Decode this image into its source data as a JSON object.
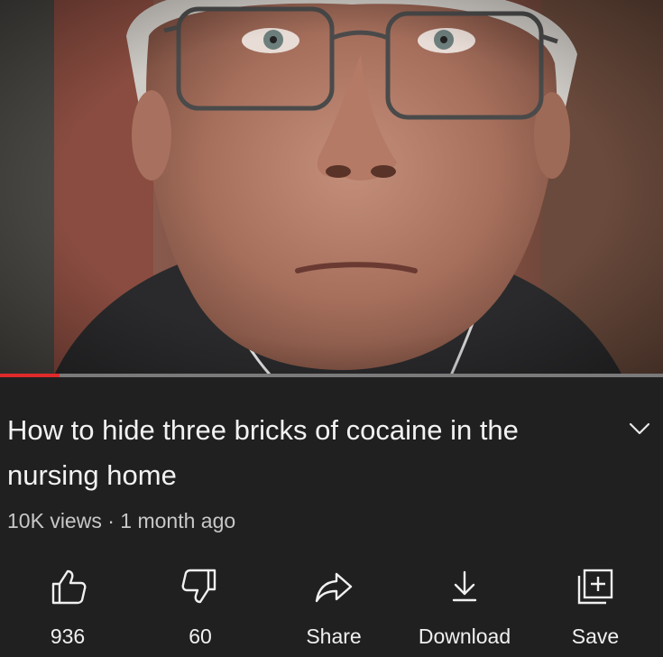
{
  "video": {
    "progress_fraction": 0.09
  },
  "title": "How to hide three bricks of cocaine in the nursing home",
  "meta": {
    "views": "10K views",
    "separator": "·",
    "age": "1 month ago"
  },
  "actions": {
    "like": {
      "label": "936",
      "icon": "thumbs-up-icon"
    },
    "dislike": {
      "label": "60",
      "icon": "thumbs-down-icon"
    },
    "share": {
      "label": "Share",
      "icon": "share-arrow-icon"
    },
    "download": {
      "label": "Download",
      "icon": "download-icon"
    },
    "save": {
      "label": "Save",
      "icon": "add-to-playlist-icon"
    }
  },
  "colors": {
    "background": "#202020",
    "progress_played": "#e02a2a",
    "progress_track": "#7a7a7a",
    "secondary_text": "#c8c8c8"
  }
}
